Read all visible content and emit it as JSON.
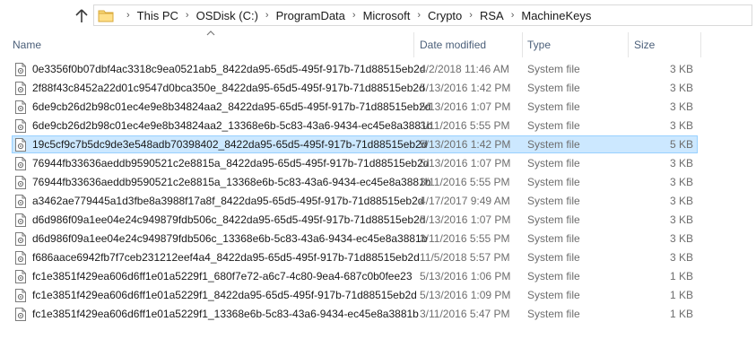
{
  "address_bar": {
    "breadcrumbs": [
      "This PC",
      "OSDisk (C:)",
      "ProgramData",
      "Microsoft",
      "Crypto",
      "RSA",
      "MachineKeys"
    ]
  },
  "columns": {
    "name": "Name",
    "date_modified": "Date modified",
    "type": "Type",
    "size": "Size"
  },
  "files": [
    {
      "name": "0e3356f0b07dbf4ac3318c9ea0521ab5_8422da95-65d5-495f-917b-71d88515eb2d",
      "date": "4/2/2018 11:46 AM",
      "type": "System file",
      "size": "3 KB",
      "selected": false
    },
    {
      "name": "2f88f43c8452a22d01c9547d0bca350e_8422da95-65d5-495f-917b-71d88515eb2d",
      "date": "5/13/2016 1:42 PM",
      "type": "System file",
      "size": "3 KB",
      "selected": false
    },
    {
      "name": "6de9cb26d2b98c01ec4e9e8b34824aa2_8422da95-65d5-495f-917b-71d88515eb2d",
      "date": "5/13/2016 1:07 PM",
      "type": "System file",
      "size": "3 KB",
      "selected": false
    },
    {
      "name": "6de9cb26d2b98c01ec4e9e8b34824aa2_13368e6b-5c83-43a6-9434-ec45e8a3881b",
      "date": "3/11/2016 5:55 PM",
      "type": "System file",
      "size": "3 KB",
      "selected": false
    },
    {
      "name": "19c5cf9c7b5dc9de3e548adb70398402_8422da95-65d5-495f-917b-71d88515eb2d",
      "date": "5/13/2016 1:42 PM",
      "type": "System file",
      "size": "5 KB",
      "selected": true
    },
    {
      "name": "76944fb33636aeddb9590521c2e8815a_8422da95-65d5-495f-917b-71d88515eb2d",
      "date": "5/13/2016 1:07 PM",
      "type": "System file",
      "size": "3 KB",
      "selected": false
    },
    {
      "name": "76944fb33636aeddb9590521c2e8815a_13368e6b-5c83-43a6-9434-ec45e8a3881b",
      "date": "3/11/2016 5:55 PM",
      "type": "System file",
      "size": "3 KB",
      "selected": false
    },
    {
      "name": "a3462ae779445a1d3fbe8a3988f17a8f_8422da95-65d5-495f-917b-71d88515eb2d",
      "date": "4/17/2017 9:49 AM",
      "type": "System file",
      "size": "3 KB",
      "selected": false
    },
    {
      "name": "d6d986f09a1ee04e24c949879fdb506c_8422da95-65d5-495f-917b-71d88515eb2d",
      "date": "5/13/2016 1:07 PM",
      "type": "System file",
      "size": "3 KB",
      "selected": false
    },
    {
      "name": "d6d986f09a1ee04e24c949879fdb506c_13368e6b-5c83-43a6-9434-ec45e8a3881b",
      "date": "3/11/2016 5:55 PM",
      "type": "System file",
      "size": "3 KB",
      "selected": false
    },
    {
      "name": "f686aace6942fb7f7ceb231212eef4a4_8422da95-65d5-495f-917b-71d88515eb2d",
      "date": "11/5/2018 5:57 PM",
      "type": "System file",
      "size": "3 KB",
      "selected": false
    },
    {
      "name": "fc1e3851f429ea606d6ff1e01a5229f1_680f7e72-a6c7-4c80-9ea4-687c0b0fee23",
      "date": "5/13/2016 1:06 PM",
      "type": "System file",
      "size": "1 KB",
      "selected": false
    },
    {
      "name": "fc1e3851f429ea606d6ff1e01a5229f1_8422da95-65d5-495f-917b-71d88515eb2d",
      "date": "5/13/2016 1:09 PM",
      "type": "System file",
      "size": "1 KB",
      "selected": false
    },
    {
      "name": "fc1e3851f429ea606d6ff1e01a5229f1_13368e6b-5c83-43a6-9434-ec45e8a3881b",
      "date": "3/11/2016 5:47 PM",
      "type": "System file",
      "size": "1 KB",
      "selected": false
    }
  ],
  "icons": {
    "up": "up-arrow-icon",
    "folder": "folder-icon",
    "file": "system-file-icon",
    "sort": "sort-ascending-icon"
  },
  "colors": {
    "selection_bg": "#cce8ff",
    "selection_border": "#99d1ff",
    "header_text": "#4c607a",
    "secondary_text": "#6d6d6d"
  }
}
